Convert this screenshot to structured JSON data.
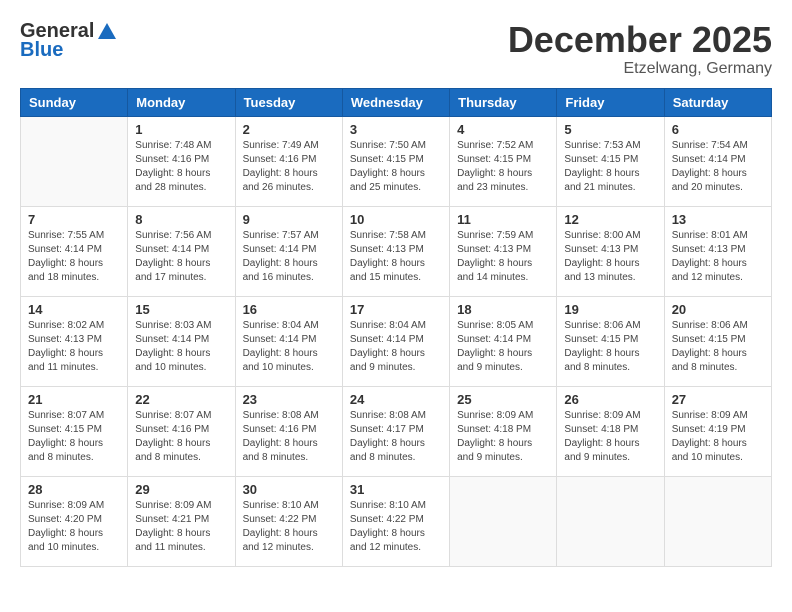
{
  "logo": {
    "general": "General",
    "blue": "Blue"
  },
  "title": "December 2025",
  "location": "Etzelwang, Germany",
  "days_of_week": [
    "Sunday",
    "Monday",
    "Tuesday",
    "Wednesday",
    "Thursday",
    "Friday",
    "Saturday"
  ],
  "weeks": [
    [
      {
        "day": "",
        "info": ""
      },
      {
        "day": "1",
        "info": "Sunrise: 7:48 AM\nSunset: 4:16 PM\nDaylight: 8 hours\nand 28 minutes."
      },
      {
        "day": "2",
        "info": "Sunrise: 7:49 AM\nSunset: 4:16 PM\nDaylight: 8 hours\nand 26 minutes."
      },
      {
        "day": "3",
        "info": "Sunrise: 7:50 AM\nSunset: 4:15 PM\nDaylight: 8 hours\nand 25 minutes."
      },
      {
        "day": "4",
        "info": "Sunrise: 7:52 AM\nSunset: 4:15 PM\nDaylight: 8 hours\nand 23 minutes."
      },
      {
        "day": "5",
        "info": "Sunrise: 7:53 AM\nSunset: 4:15 PM\nDaylight: 8 hours\nand 21 minutes."
      },
      {
        "day": "6",
        "info": "Sunrise: 7:54 AM\nSunset: 4:14 PM\nDaylight: 8 hours\nand 20 minutes."
      }
    ],
    [
      {
        "day": "7",
        "info": "Sunrise: 7:55 AM\nSunset: 4:14 PM\nDaylight: 8 hours\nand 18 minutes."
      },
      {
        "day": "8",
        "info": "Sunrise: 7:56 AM\nSunset: 4:14 PM\nDaylight: 8 hours\nand 17 minutes."
      },
      {
        "day": "9",
        "info": "Sunrise: 7:57 AM\nSunset: 4:14 PM\nDaylight: 8 hours\nand 16 minutes."
      },
      {
        "day": "10",
        "info": "Sunrise: 7:58 AM\nSunset: 4:13 PM\nDaylight: 8 hours\nand 15 minutes."
      },
      {
        "day": "11",
        "info": "Sunrise: 7:59 AM\nSunset: 4:13 PM\nDaylight: 8 hours\nand 14 minutes."
      },
      {
        "day": "12",
        "info": "Sunrise: 8:00 AM\nSunset: 4:13 PM\nDaylight: 8 hours\nand 13 minutes."
      },
      {
        "day": "13",
        "info": "Sunrise: 8:01 AM\nSunset: 4:13 PM\nDaylight: 8 hours\nand 12 minutes."
      }
    ],
    [
      {
        "day": "14",
        "info": "Sunrise: 8:02 AM\nSunset: 4:13 PM\nDaylight: 8 hours\nand 11 minutes."
      },
      {
        "day": "15",
        "info": "Sunrise: 8:03 AM\nSunset: 4:14 PM\nDaylight: 8 hours\nand 10 minutes."
      },
      {
        "day": "16",
        "info": "Sunrise: 8:04 AM\nSunset: 4:14 PM\nDaylight: 8 hours\nand 10 minutes."
      },
      {
        "day": "17",
        "info": "Sunrise: 8:04 AM\nSunset: 4:14 PM\nDaylight: 8 hours\nand 9 minutes."
      },
      {
        "day": "18",
        "info": "Sunrise: 8:05 AM\nSunset: 4:14 PM\nDaylight: 8 hours\nand 9 minutes."
      },
      {
        "day": "19",
        "info": "Sunrise: 8:06 AM\nSunset: 4:15 PM\nDaylight: 8 hours\nand 8 minutes."
      },
      {
        "day": "20",
        "info": "Sunrise: 8:06 AM\nSunset: 4:15 PM\nDaylight: 8 hours\nand 8 minutes."
      }
    ],
    [
      {
        "day": "21",
        "info": "Sunrise: 8:07 AM\nSunset: 4:15 PM\nDaylight: 8 hours\nand 8 minutes."
      },
      {
        "day": "22",
        "info": "Sunrise: 8:07 AM\nSunset: 4:16 PM\nDaylight: 8 hours\nand 8 minutes."
      },
      {
        "day": "23",
        "info": "Sunrise: 8:08 AM\nSunset: 4:16 PM\nDaylight: 8 hours\nand 8 minutes."
      },
      {
        "day": "24",
        "info": "Sunrise: 8:08 AM\nSunset: 4:17 PM\nDaylight: 8 hours\nand 8 minutes."
      },
      {
        "day": "25",
        "info": "Sunrise: 8:09 AM\nSunset: 4:18 PM\nDaylight: 8 hours\nand 9 minutes."
      },
      {
        "day": "26",
        "info": "Sunrise: 8:09 AM\nSunset: 4:18 PM\nDaylight: 8 hours\nand 9 minutes."
      },
      {
        "day": "27",
        "info": "Sunrise: 8:09 AM\nSunset: 4:19 PM\nDaylight: 8 hours\nand 10 minutes."
      }
    ],
    [
      {
        "day": "28",
        "info": "Sunrise: 8:09 AM\nSunset: 4:20 PM\nDaylight: 8 hours\nand 10 minutes."
      },
      {
        "day": "29",
        "info": "Sunrise: 8:09 AM\nSunset: 4:21 PM\nDaylight: 8 hours\nand 11 minutes."
      },
      {
        "day": "30",
        "info": "Sunrise: 8:10 AM\nSunset: 4:22 PM\nDaylight: 8 hours\nand 12 minutes."
      },
      {
        "day": "31",
        "info": "Sunrise: 8:10 AM\nSunset: 4:22 PM\nDaylight: 8 hours\nand 12 minutes."
      },
      {
        "day": "",
        "info": ""
      },
      {
        "day": "",
        "info": ""
      },
      {
        "day": "",
        "info": ""
      }
    ]
  ]
}
